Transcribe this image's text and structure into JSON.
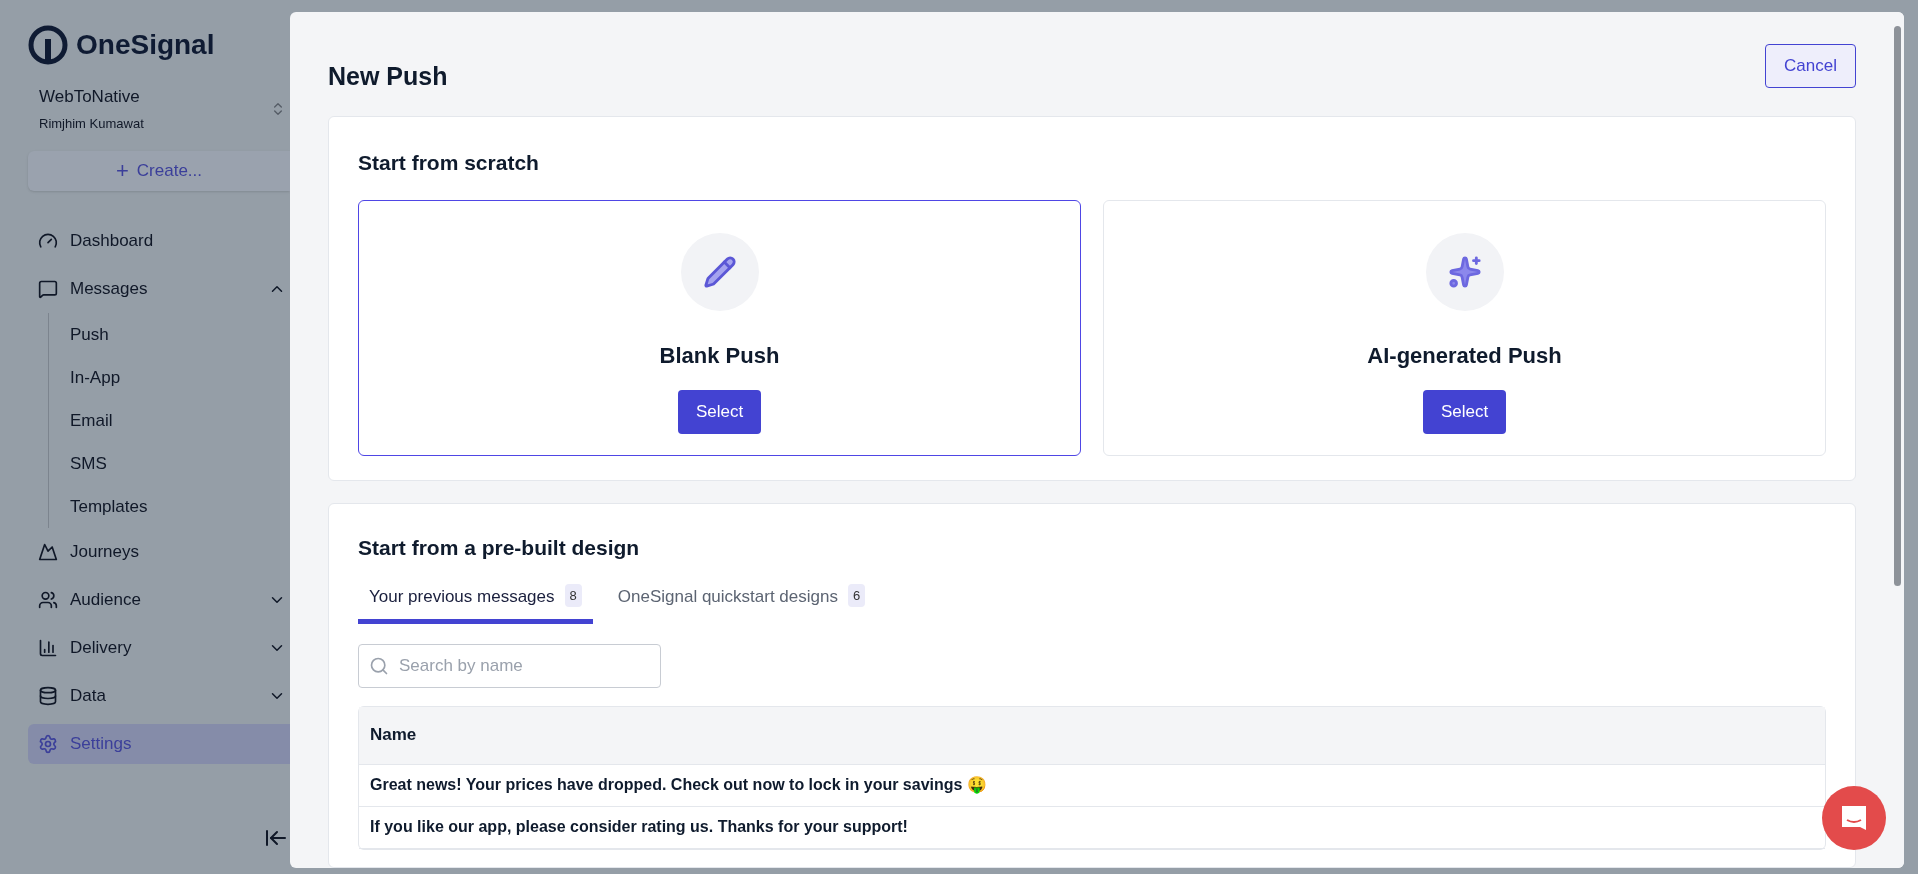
{
  "sidebar": {
    "logo": "OneSignal",
    "app": {
      "name": "WebToNative",
      "user": "Rimjhim Kumawat"
    },
    "create_button": "Create...",
    "create_icon": "+",
    "items": [
      {
        "label": "Dashboard",
        "selected": false
      },
      {
        "label": "Messages",
        "selected": false,
        "expanded": true,
        "children": [
          {
            "label": "Push",
            "selected": false
          },
          {
            "label": "In-App",
            "selected": false
          },
          {
            "label": "Email",
            "selected": false
          },
          {
            "label": "SMS",
            "selected": false
          },
          {
            "label": "Templates",
            "selected": false
          }
        ]
      },
      {
        "label": "Journeys",
        "selected": false
      },
      {
        "label": "Audience",
        "selected": false,
        "expanded": false
      },
      {
        "label": "Delivery",
        "selected": false,
        "expanded": false
      },
      {
        "label": "Data",
        "selected": false,
        "expanded": false
      },
      {
        "label": "Settings",
        "selected": true
      }
    ]
  },
  "modal": {
    "title": "New Push",
    "cancel_button": "Cancel",
    "scratch": {
      "heading": "Start from scratch",
      "options": [
        {
          "title": "Blank Push",
          "button": "Select",
          "selected": true
        },
        {
          "title": "AI-generated Push",
          "button": "Select",
          "selected": false
        }
      ]
    },
    "prebuilt": {
      "heading": "Start from a pre-built design",
      "tabs": [
        {
          "label": "Your previous messages",
          "count": "8",
          "selected": true
        },
        {
          "label": "OneSignal quickstart designs",
          "count": "6",
          "selected": false
        }
      ],
      "search": {
        "placeholder": "Search by name"
      },
      "table": {
        "columns": [
          "Name"
        ],
        "rows": [
          [
            "Great news! Your prices have dropped. Check out now to lock in your savings 🤑"
          ],
          [
            "If you like our app, please consider rating us. Thanks for your support!"
          ]
        ]
      }
    }
  }
}
